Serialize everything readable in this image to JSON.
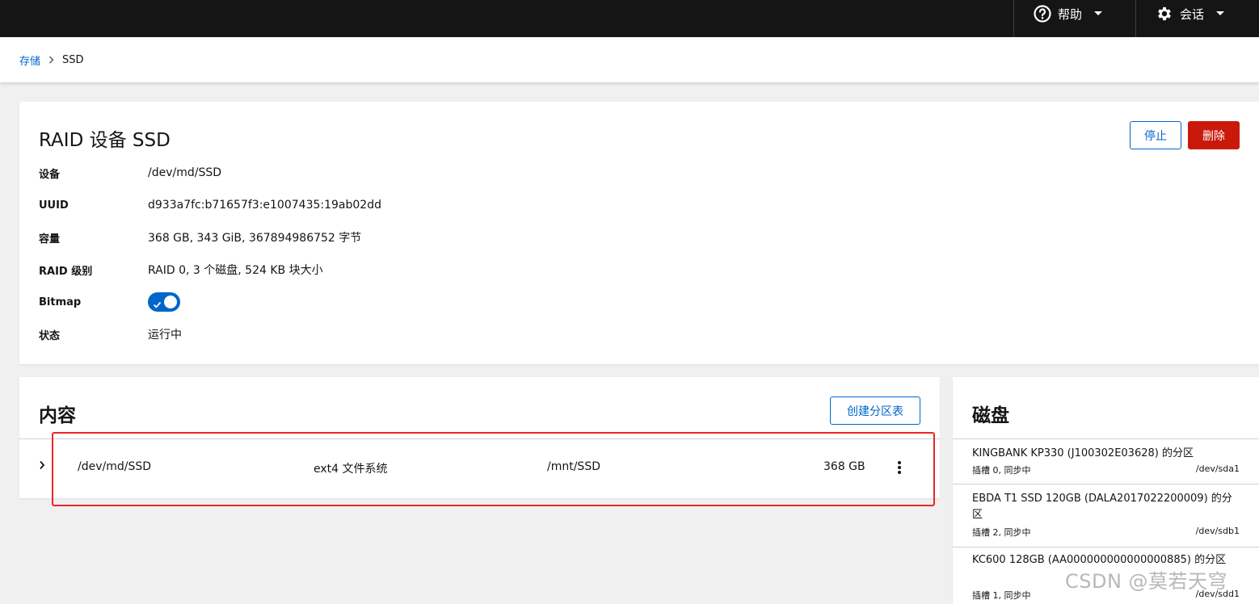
{
  "topbar": {
    "help_label": "帮助",
    "session_label": "会话"
  },
  "breadcrumb": {
    "parent": "存储",
    "current": "SSD"
  },
  "raid": {
    "title": "RAID 设备 SSD",
    "stop_label": "停止",
    "delete_label": "删除",
    "props": [
      {
        "label": "设备",
        "value": "/dev/md/SSD"
      },
      {
        "label": "UUID",
        "value": "d933a7fc:b71657f3:e1007435:19ab02dd"
      },
      {
        "label": "容量",
        "value": "368 GB, 343 GiB, 367894986752 字节"
      },
      {
        "label": "RAID 级别",
        "value": "RAID 0, 3 个磁盘, 524 KB 块大小"
      },
      {
        "label": "Bitmap",
        "value": ""
      },
      {
        "label": "状态",
        "value": "运行中"
      }
    ],
    "bitmap_enabled": true
  },
  "content": {
    "title": "内容",
    "create_label": "创建分区表",
    "rows": [
      {
        "device": "/dev/md/SSD",
        "fs": "ext4 文件系统",
        "mount": "/mnt/SSD",
        "size": "368 GB"
      }
    ]
  },
  "disks": {
    "title": "磁盘",
    "items": [
      {
        "name": "KINGBANK KP330 (J100302E03628) 的分区",
        "status": "插槽 0, 同步中",
        "dev": "/dev/sda1"
      },
      {
        "name": "EBDA T1 SSD 120GB (DALA2017022200009) 的分区",
        "status": "插槽 2, 同步中",
        "dev": "/dev/sdb1"
      },
      {
        "name": "KC600 128GB (AA000000000000000885) 的分区",
        "status": "插槽 1, 同步中",
        "dev": "/dev/sdd1"
      }
    ]
  },
  "watermark": "CSDN @莫若天穹",
  "colors": {
    "accent": "#0066cc",
    "danger": "#c9190b",
    "topbar": "#151515",
    "highlight": "#e8262b"
  }
}
